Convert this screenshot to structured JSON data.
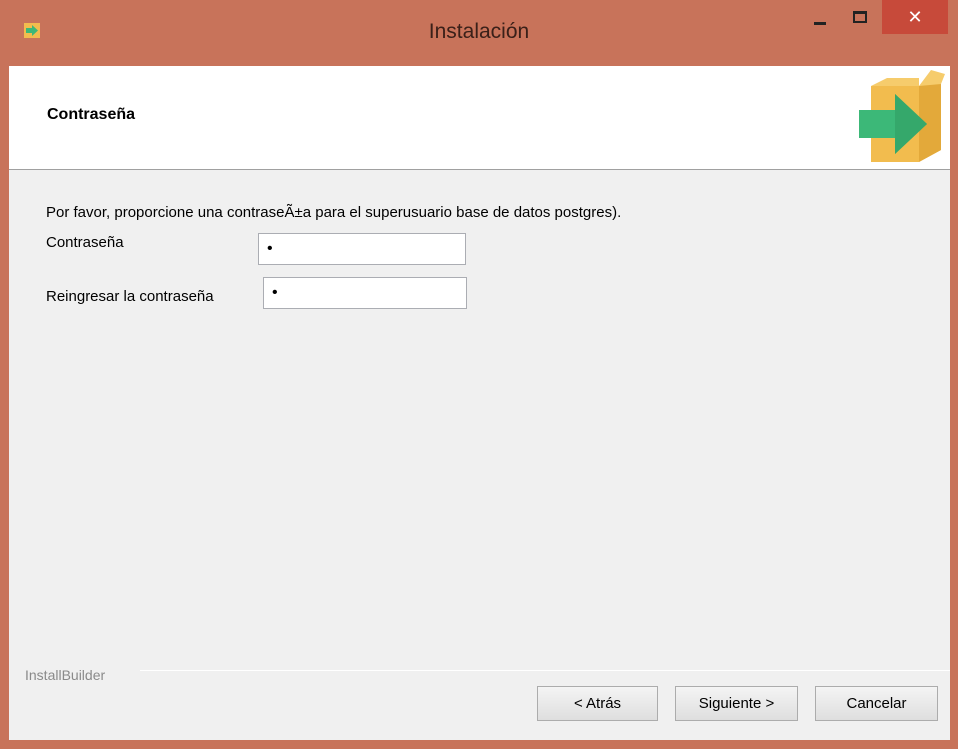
{
  "window": {
    "title": "Instalación",
    "close_glyph": "✕"
  },
  "header": {
    "title": "Contraseña"
  },
  "form": {
    "description": "Por favor, proporcione una contraseÃ±a para el superusuario base de datos postgres).",
    "password_label": "Contraseña",
    "password_value": "•",
    "confirm_label": "Reingresar la contraseña",
    "confirm_value": "•"
  },
  "footer": {
    "builder_label": "InstallBuilder",
    "back_label": "< Atrás",
    "next_label": "Siguiente >",
    "cancel_label": "Cancelar"
  },
  "icons": {
    "app": "installer-box-arrow-icon",
    "header": "installer-box-arrow-icon"
  },
  "colors": {
    "titlebar": "#c8735a",
    "close_button": "#c74a3a",
    "client_bg": "#f0f0f0",
    "box": "#f2bc4e",
    "arrow": "#3cb878"
  }
}
